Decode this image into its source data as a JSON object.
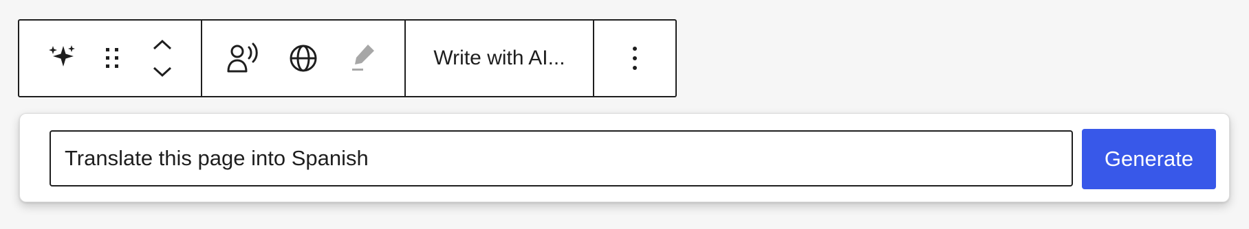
{
  "toolbar": {
    "icons": {
      "ai": "sparkles-icon",
      "drag": "drag-handle-icon",
      "move": "move-up-down-icon",
      "voice": "voice-speaker-icon",
      "language": "globe-icon",
      "highlight": "highlighter-icon",
      "more": "more-vertical-icon"
    },
    "write_with_ai_label": "Write with AI..."
  },
  "prompt_popover": {
    "input_value": "Translate this page into Spanish",
    "generate_label": "Generate"
  },
  "colors": {
    "accent": "#3858e9",
    "border": "#1e1e1e",
    "muted_icon": "#a7a7a7"
  }
}
